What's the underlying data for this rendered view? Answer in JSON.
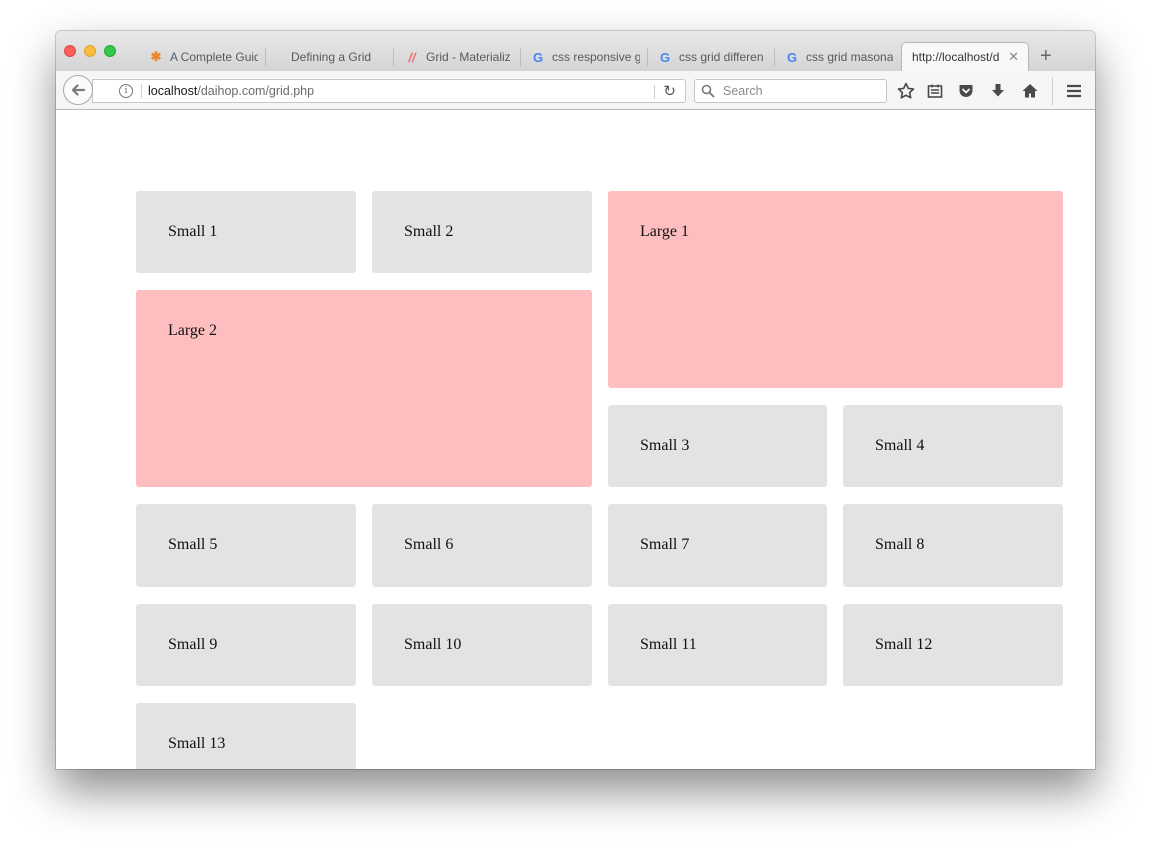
{
  "browser": {
    "tabs": [
      {
        "label": "A Complete Guid",
        "favicon": "asterisk-icon",
        "favicon_color": "#e8862a"
      },
      {
        "label": "Defining a Grid",
        "favicon": "",
        "favicon_color": ""
      },
      {
        "label": "Grid - Materializ",
        "favicon": "materialize-icon",
        "favicon_color": "#ee6e73"
      },
      {
        "label": "css responsive g",
        "favicon": "google-icon",
        "favicon_color": "#4285f4"
      },
      {
        "label": "css grid differen",
        "favicon": "google-icon",
        "favicon_color": "#4285f4"
      },
      {
        "label": "css grid masona",
        "favicon": "google-icon",
        "favicon_color": "#4285f4"
      },
      {
        "label": "http://localhost/d",
        "favicon": "",
        "favicon_color": "",
        "active": true
      }
    ],
    "new_tab": "+",
    "tab_close": "✕",
    "url_host": "localhost",
    "url_path": "/daihop.com/grid.php",
    "search_placeholder": "Search"
  },
  "grid": {
    "small_1": "Small 1",
    "small_2": "Small 2",
    "large_1": "Large 1",
    "large_2": "Large 2",
    "small_3": "Small 3",
    "small_4": "Small 4",
    "small_5": "Small 5",
    "small_6": "Small 6",
    "small_7": "Small 7",
    "small_8": "Small 8",
    "small_9": "Small 9",
    "small_10": "Small 10",
    "small_11": "Small 11",
    "small_12": "Small 12",
    "small_13": "Small 13"
  },
  "colors": {
    "small_cell": "#e3e3e3",
    "large_cell": "#febebf"
  }
}
